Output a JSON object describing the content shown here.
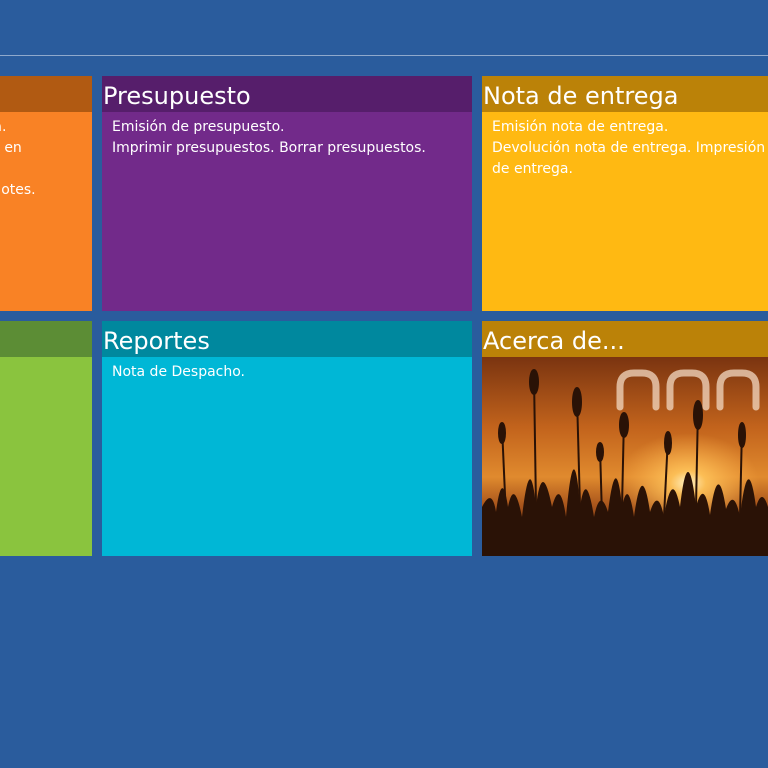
{
  "tiles": {
    "partial_top": {
      "body_lines": "ita.\nas en\n\nn lotes.",
      "color": "#f98225",
      "header_color": "#b15a12"
    },
    "presupuesto": {
      "title": "Presupuesto",
      "body_lines": "Emisión de presupuesto.\nImprimir presupuestos. Borrar presupuestos.",
      "color": "#722a8a",
      "header_color": "#561e6b"
    },
    "nota_entrega": {
      "title": "Nota de entrega",
      "body_lines": "Emisión nota de entrega.\nDevolución nota de entrega. Impresión d\nde entrega.",
      "color": "#ffb912",
      "header_color": "#bb8208"
    },
    "partial_bottom": {
      "color": "#8ac43e",
      "header_color": "#5c8d35"
    },
    "reportes": {
      "title": "Reportes",
      "body_lines": "Nota de Despacho.",
      "color": "#00b7d6",
      "header_color": "#00889e"
    },
    "acerca": {
      "title": "Acerca de...",
      "color": "#bb8208",
      "header_color": "#bb8208"
    }
  }
}
